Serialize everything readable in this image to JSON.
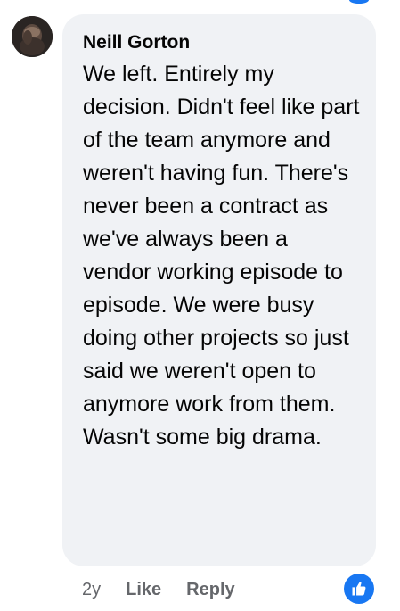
{
  "comment": {
    "author": "Neill Gorton",
    "text": "We left. Entirely my decision. Didn't feel like part of the team anymore and weren't having fun. There's never been a contract as we've always been a vendor working episode to episode. We were busy doing other projects so just said we weren't open to anymore work from them. Wasn't some big drama.",
    "timestamp": "2y",
    "actions": {
      "like_label": "Like",
      "reply_label": "Reply"
    },
    "reaction_icon": "thumbs-up-icon"
  },
  "colors": {
    "bubble_bg": "#f0f2f5",
    "text": "#050505",
    "secondary_text": "#65676b",
    "reaction_blue": "#1877f2"
  }
}
